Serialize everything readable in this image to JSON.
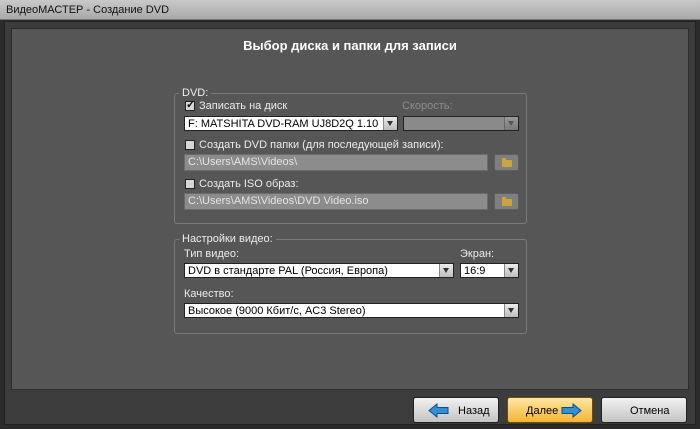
{
  "window": {
    "title": "ВидеоМАСТЕР - Создание DVD"
  },
  "page": {
    "title": "Выбор диска и папки для записи"
  },
  "dvd": {
    "legend": "DVD:",
    "burn_checkbox": {
      "label": "Записать на диск",
      "checked": true
    },
    "drive": {
      "value": "F: MATSHITA DVD-RAM UJ8D2Q   1.10"
    },
    "speed": {
      "label": "Скорость:",
      "value": ""
    },
    "folder_checkbox": {
      "label": "Создать DVD папки (для последующей записи):",
      "checked": false
    },
    "folder_path": "C:\\Users\\AMS\\Videos\\",
    "iso_checkbox": {
      "label": "Создать ISO образ:",
      "checked": false
    },
    "iso_path": "C:\\Users\\AMS\\Videos\\DVD Video.iso"
  },
  "video": {
    "legend": "Настройки видео:",
    "type_label": "Тип видео:",
    "type_value": "DVD в стандарте PAL (Россия, Европа)",
    "screen_label": "Экран:",
    "screen_value": "16:9",
    "quality_label": "Качество:",
    "quality_value": "Высокое (9000 Кбит/с, AC3 Stereo)"
  },
  "buttons": {
    "back": "Назад",
    "next": "Далее",
    "cancel": "Отмена"
  },
  "icons": {
    "check": "✓"
  },
  "colors": {
    "accent": "#f5b433",
    "arrow_blue": "#2f8fd8"
  }
}
